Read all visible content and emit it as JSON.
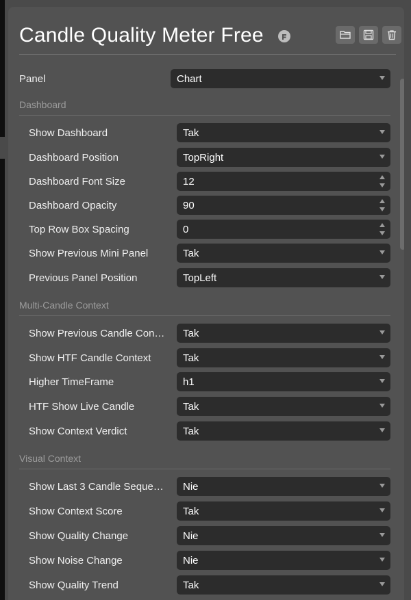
{
  "header": {
    "title": "Candle Quality Meter Free",
    "actions": [
      "open-folder-icon",
      "save-icon",
      "trash-icon"
    ]
  },
  "colors": {
    "panel_bg": "#525252",
    "field_bg": "#2c2c2c",
    "section_text": "#9c9c9c"
  },
  "panel_select": {
    "label": "Panel",
    "value": "Chart"
  },
  "sections": [
    {
      "title": "Dashboard",
      "rows": [
        {
          "label": "Show Dashboard",
          "value": "Tak",
          "kind": "select"
        },
        {
          "label": "Dashboard Position",
          "value": "TopRight",
          "kind": "select"
        },
        {
          "label": "Dashboard Font Size",
          "value": "12",
          "kind": "number"
        },
        {
          "label": "Dashboard Opacity",
          "value": "90",
          "kind": "number"
        },
        {
          "label": "Top Row Box Spacing",
          "value": "0",
          "kind": "number"
        },
        {
          "label": "Show Previous Mini Panel",
          "value": "Tak",
          "kind": "select"
        },
        {
          "label": "Previous Panel Position",
          "value": "TopLeft",
          "kind": "select"
        }
      ]
    },
    {
      "title": "Multi-Candle Context",
      "rows": [
        {
          "label": "Show Previous Candle Con…",
          "value": "Tak",
          "kind": "select"
        },
        {
          "label": "Show HTF Candle Context",
          "value": "Tak",
          "kind": "select"
        },
        {
          "label": "Higher TimeFrame",
          "value": "h1",
          "kind": "select"
        },
        {
          "label": "HTF Show Live Candle",
          "value": "Tak",
          "kind": "select"
        },
        {
          "label": "Show Context Verdict",
          "value": "Tak",
          "kind": "select"
        }
      ]
    },
    {
      "title": "Visual Context",
      "rows": [
        {
          "label": "Show Last 3 Candle Seque…",
          "value": "Nie",
          "kind": "select"
        },
        {
          "label": "Show Context Score",
          "value": "Tak",
          "kind": "select"
        },
        {
          "label": "Show Quality Change",
          "value": "Nie",
          "kind": "select"
        },
        {
          "label": "Show Noise Change",
          "value": "Nie",
          "kind": "select"
        },
        {
          "label": "Show Quality Trend",
          "value": "Tak",
          "kind": "select"
        }
      ]
    }
  ]
}
